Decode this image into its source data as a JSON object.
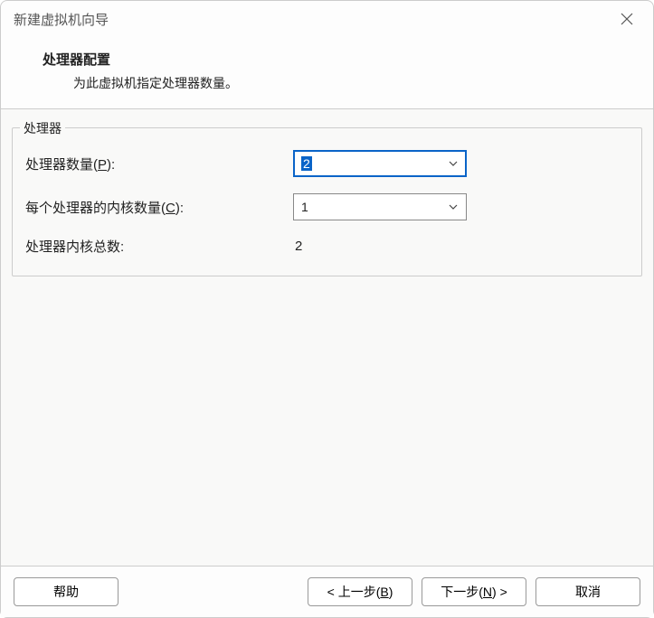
{
  "window": {
    "title": "新建虚拟机向导"
  },
  "header": {
    "title": "处理器配置",
    "subtitle": "为此虚拟机指定处理器数量。"
  },
  "fieldset": {
    "legend": "处理器"
  },
  "labels": {
    "processors_prefix": "处理器数量(",
    "processors_hotkey": "P",
    "processors_suffix": "):",
    "cores_prefix": "每个处理器的内核数量(",
    "cores_hotkey": "C",
    "cores_suffix": "):",
    "total": "处理器内核总数:"
  },
  "values": {
    "processors": "2",
    "cores": "1",
    "total": "2"
  },
  "buttons": {
    "help": "帮助",
    "back_prefix": "< 上一步(",
    "back_hotkey": "B",
    "back_suffix": ")",
    "next_prefix": "下一步(",
    "next_hotkey": "N",
    "next_suffix": ") >",
    "cancel": "取消"
  }
}
